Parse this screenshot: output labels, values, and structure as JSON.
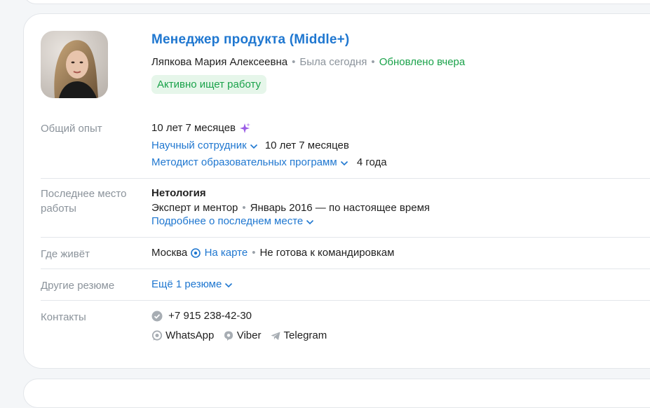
{
  "header": {
    "title": "Менеджер продукта (Middle+)",
    "name": "Ляпкова Мария Алексеевна",
    "last_seen": "Была сегодня",
    "updated": "Обновлено вчера",
    "status_badge": "Активно ищет работу"
  },
  "experience": {
    "label": "Общий опыт",
    "total": "10 лет 7 месяцев",
    "roles": [
      {
        "title": "Научный сотрудник",
        "duration": "10 лет 7 месяцев"
      },
      {
        "title": "Методист образовательных программ",
        "duration": "4 года"
      }
    ]
  },
  "last_job": {
    "label": "Последнее место работы",
    "company": "Нетология",
    "position": "Эксперт и ментор",
    "period": "Январь 2016 — по настоящее время",
    "more_link": "Подробнее о последнем месте"
  },
  "location": {
    "label": "Где живёт",
    "city": "Москва",
    "map_link": "На карте",
    "travel": "Не готова к командировкам"
  },
  "other_resumes": {
    "label": "Другие резюме",
    "link": "Ещё 1 резюме"
  },
  "contacts": {
    "label": "Контакты",
    "phone": "+7 915 238-42-30",
    "messengers": [
      "WhatsApp",
      "Viber",
      "Telegram"
    ]
  },
  "colors": {
    "link": "#1f77d0",
    "green": "#1aa24a",
    "muted": "#8b939b",
    "sparkle": "#9b5de5"
  }
}
